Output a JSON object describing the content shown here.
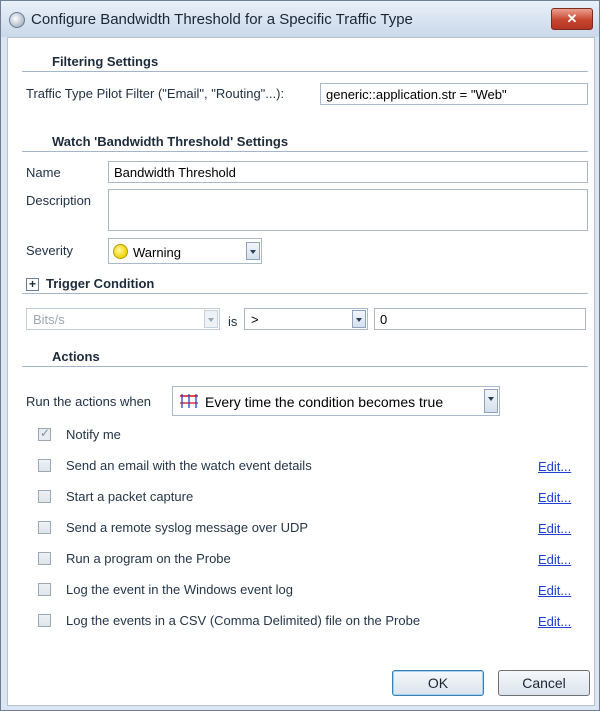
{
  "window": {
    "title": "Configure Bandwidth Threshold for a Specific Traffic Type",
    "close_label": "✕"
  },
  "filtering": {
    "heading": "Filtering Settings",
    "label": "Traffic Type Pilot Filter (\"Email\", \"Routing\"...):",
    "value": "generic::application.str = \"Web\""
  },
  "watch": {
    "heading": "Watch 'Bandwidth Threshold' Settings",
    "name_label": "Name",
    "name_value": "Bandwidth Threshold",
    "description_label": "Description",
    "description_value": "",
    "severity_label": "Severity",
    "severity_value": "Warning",
    "severity_color": "#f0d400"
  },
  "trigger": {
    "heading": "Trigger Condition",
    "expand_glyph": "+",
    "metric": "Bits/s",
    "is_label": "is",
    "operator": ">",
    "value": "0"
  },
  "actions": {
    "heading": "Actions",
    "run_label": "Run the actions when",
    "run_value": "Every time the condition becomes true",
    "notify_label": "Notify me",
    "notify_checked": true,
    "items": [
      {
        "label": "Send an email with the watch event details",
        "link": "Edit...",
        "checked": false
      },
      {
        "label": "Start a packet capture",
        "link": "Edit...",
        "checked": false
      },
      {
        "label": "Send a remote syslog message over UDP",
        "link": "Edit...",
        "checked": false
      },
      {
        "label": "Run a program on the Probe",
        "link": "Edit...",
        "checked": false
      },
      {
        "label": "Log the event in the Windows event log",
        "link": "Edit...",
        "checked": false
      },
      {
        "label": "Log the events in a CSV (Comma Delimited) file on the Probe",
        "link": "Edit...",
        "checked": false
      }
    ]
  },
  "buttons": {
    "ok": "OK",
    "cancel": "Cancel"
  },
  "colors": {
    "accent": "#1e3fd0",
    "close": "#c8452f",
    "window_bg": "#dce6f2"
  }
}
